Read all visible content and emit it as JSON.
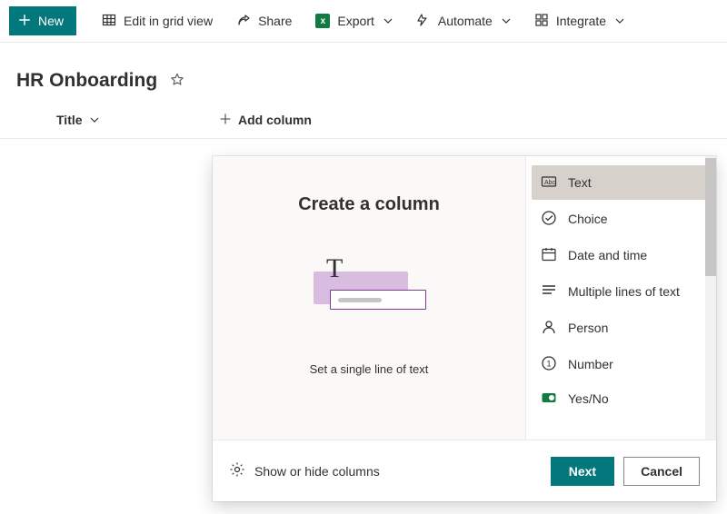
{
  "toolbar": {
    "new_label": "New",
    "grid_label": "Edit in grid view",
    "share_label": "Share",
    "export_label": "Export",
    "automate_label": "Automate",
    "integrate_label": "Integrate"
  },
  "list": {
    "title": "HR Onboarding"
  },
  "columns": {
    "title_header": "Title",
    "add_column": "Add column"
  },
  "panel": {
    "title": "Create a column",
    "description": "Set a single line of text",
    "show_hide": "Show or hide columns",
    "next": "Next",
    "cancel": "Cancel",
    "types": [
      {
        "label": "Text",
        "icon": "text",
        "selected": true
      },
      {
        "label": "Choice",
        "icon": "choice",
        "selected": false
      },
      {
        "label": "Date and time",
        "icon": "calendar",
        "selected": false
      },
      {
        "label": "Multiple lines of text",
        "icon": "multiline",
        "selected": false
      },
      {
        "label": "Person",
        "icon": "person",
        "selected": false
      },
      {
        "label": "Number",
        "icon": "number",
        "selected": false
      },
      {
        "label": "Yes/No",
        "icon": "yesno",
        "selected": false
      }
    ]
  }
}
